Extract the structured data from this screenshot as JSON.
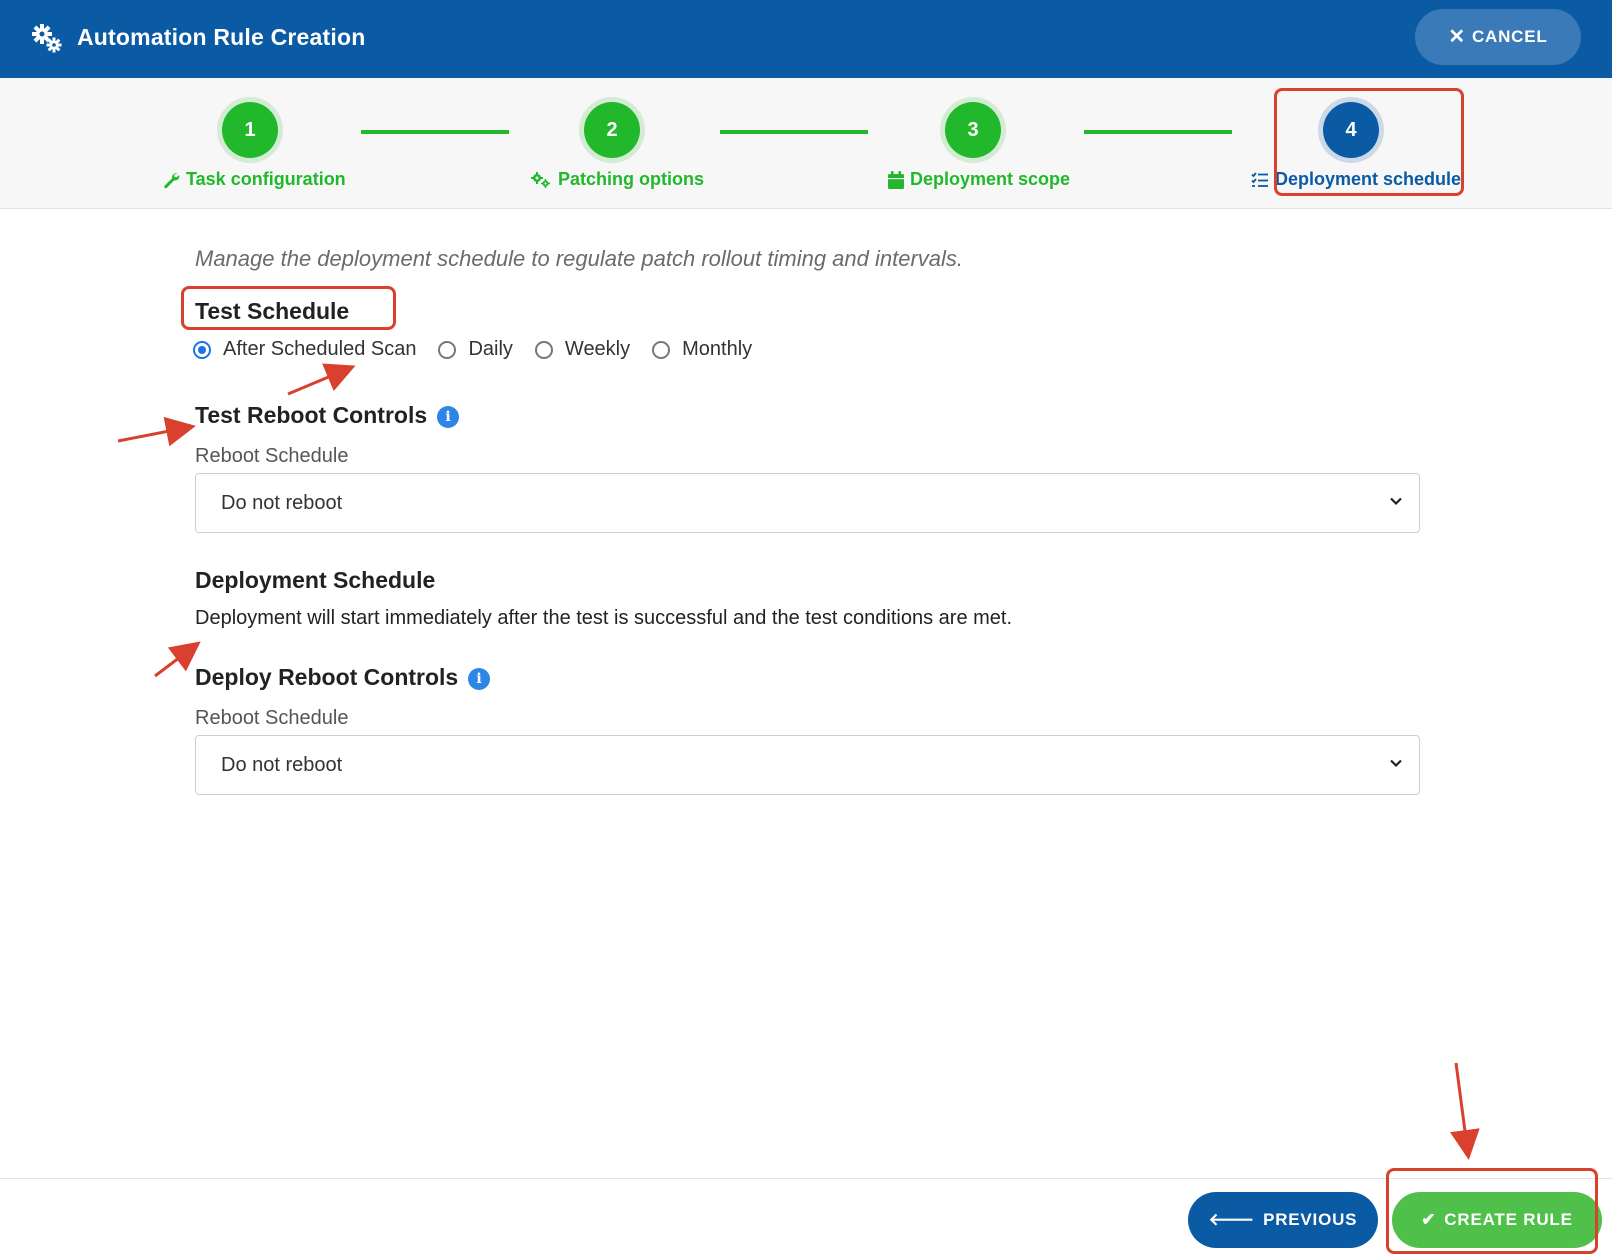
{
  "header": {
    "title": "Automation Rule Creation",
    "icon": "gears-icon",
    "cancel_label": "CANCEL",
    "background": "#0b5aa4"
  },
  "stepper": {
    "steps": [
      {
        "number": "1",
        "label": "Task configuration",
        "icon": "wrench-icon",
        "state": "done"
      },
      {
        "number": "2",
        "label": "Patching options",
        "icon": "gears-icon",
        "state": "done"
      },
      {
        "number": "3",
        "label": "Deployment scope",
        "icon": "calendar-icon",
        "state": "done"
      },
      {
        "number": "4",
        "label": "Deployment schedule",
        "icon": "checklist-icon",
        "state": "active"
      }
    ],
    "done_color": "#22b82b",
    "active_color": "#0b5aa4"
  },
  "content": {
    "intro": "Manage the deployment schedule to regulate patch rollout timing and intervals.",
    "test_schedule": {
      "title": "Test Schedule",
      "options": [
        "After Scheduled Scan",
        "Daily",
        "Weekly",
        "Monthly"
      ],
      "selected": "After Scheduled Scan"
    },
    "test_reboot": {
      "title": "Test Reboot Controls",
      "field_label": "Reboot Schedule",
      "value": "Do not reboot"
    },
    "deployment_schedule": {
      "title": "Deployment Schedule",
      "description": "Deployment will start immediately after the test is successful and the test conditions are met."
    },
    "deploy_reboot": {
      "title": "Deploy Reboot Controls",
      "field_label": "Reboot Schedule",
      "value": "Do not reboot"
    }
  },
  "footer": {
    "previous_label": "PREVIOUS",
    "create_label": "CREATE RULE",
    "create_color": "#4fc14a"
  },
  "annotation_color": "#d9402e"
}
